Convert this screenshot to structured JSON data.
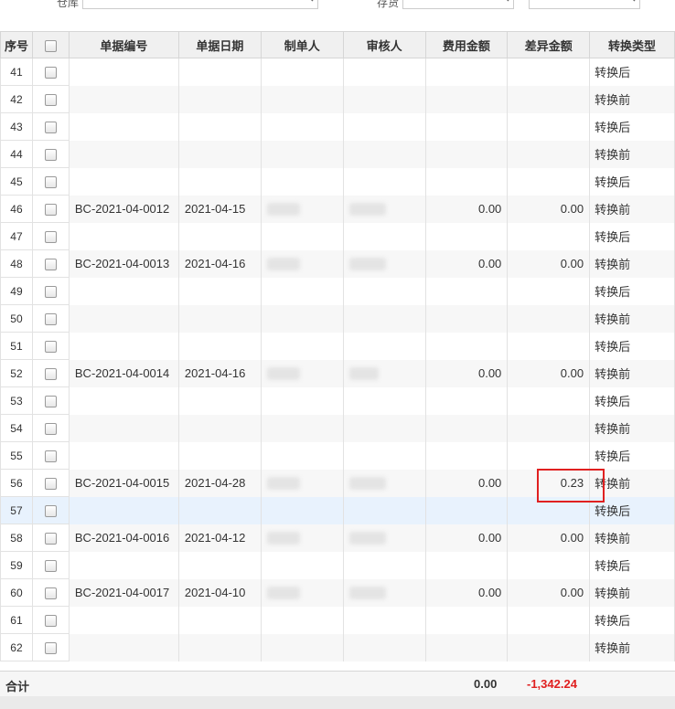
{
  "filters": {
    "warehouse_label": "仓库",
    "custodian_label": "存货"
  },
  "table": {
    "columns": [
      "序号",
      "",
      "单据编号",
      "单据日期",
      "制单人",
      "审核人",
      "费用金额",
      "差异金额",
      "转换类型"
    ],
    "rows": [
      {
        "idx": "41",
        "doc": "",
        "date": "",
        "fee": "",
        "diff": "",
        "type": "转换后"
      },
      {
        "idx": "42",
        "doc": "",
        "date": "",
        "fee": "",
        "diff": "",
        "type": "转换前"
      },
      {
        "idx": "43",
        "doc": "",
        "date": "",
        "fee": "",
        "diff": "",
        "type": "转换后"
      },
      {
        "idx": "44",
        "doc": "",
        "date": "",
        "fee": "",
        "diff": "",
        "type": "转换前"
      },
      {
        "idx": "45",
        "doc": "",
        "date": "",
        "fee": "",
        "diff": "",
        "type": "转换后"
      },
      {
        "idx": "46",
        "doc": "BC-2021-04-0012",
        "date": "2021-04-15",
        "fee": "0.00",
        "diff": "0.00",
        "type": "转换前"
      },
      {
        "idx": "47",
        "doc": "",
        "date": "",
        "fee": "",
        "diff": "",
        "type": "转换后"
      },
      {
        "idx": "48",
        "doc": "BC-2021-04-0013",
        "date": "2021-04-16",
        "fee": "0.00",
        "diff": "0.00",
        "type": "转换前"
      },
      {
        "idx": "49",
        "doc": "",
        "date": "",
        "fee": "",
        "diff": "",
        "type": "转换后"
      },
      {
        "idx": "50",
        "doc": "",
        "date": "",
        "fee": "",
        "diff": "",
        "type": "转换前"
      },
      {
        "idx": "51",
        "doc": "",
        "date": "",
        "fee": "",
        "diff": "",
        "type": "转换后"
      },
      {
        "idx": "52",
        "doc": "BC-2021-04-0014",
        "date": "2021-04-16",
        "fee": "0.00",
        "diff": "0.00",
        "type": "转换前"
      },
      {
        "idx": "53",
        "doc": "",
        "date": "",
        "fee": "",
        "diff": "",
        "type": "转换后"
      },
      {
        "idx": "54",
        "doc": "",
        "date": "",
        "fee": "",
        "diff": "",
        "type": "转换前"
      },
      {
        "idx": "55",
        "doc": "",
        "date": "",
        "fee": "",
        "diff": "",
        "type": "转换后"
      },
      {
        "idx": "56",
        "doc": "BC-2021-04-0015",
        "date": "2021-04-28",
        "fee": "0.00",
        "diff": "0.23",
        "type": "转换前"
      },
      {
        "idx": "57",
        "doc": "",
        "date": "",
        "fee": "",
        "diff": "",
        "type": "转换后"
      },
      {
        "idx": "58",
        "doc": "BC-2021-04-0016",
        "date": "2021-04-12",
        "fee": "0.00",
        "diff": "0.00",
        "type": "转换前"
      },
      {
        "idx": "59",
        "doc": "",
        "date": "",
        "fee": "",
        "diff": "",
        "type": "转换后"
      },
      {
        "idx": "60",
        "doc": "BC-2021-04-0017",
        "date": "2021-04-10",
        "fee": "0.00",
        "diff": "0.00",
        "type": "转换前"
      },
      {
        "idx": "61",
        "doc": "",
        "date": "",
        "fee": "",
        "diff": "",
        "type": "转换后"
      },
      {
        "idx": "62",
        "doc": "",
        "date": "",
        "fee": "",
        "diff": "",
        "type": "转换前"
      }
    ]
  },
  "footer": {
    "label": "合计",
    "fee_total": "0.00",
    "diff_total": "-1,342.24"
  },
  "colors": {
    "negative": "#e02020",
    "highlight_box": "#e02020",
    "selected_row": "#e8f2fd"
  }
}
